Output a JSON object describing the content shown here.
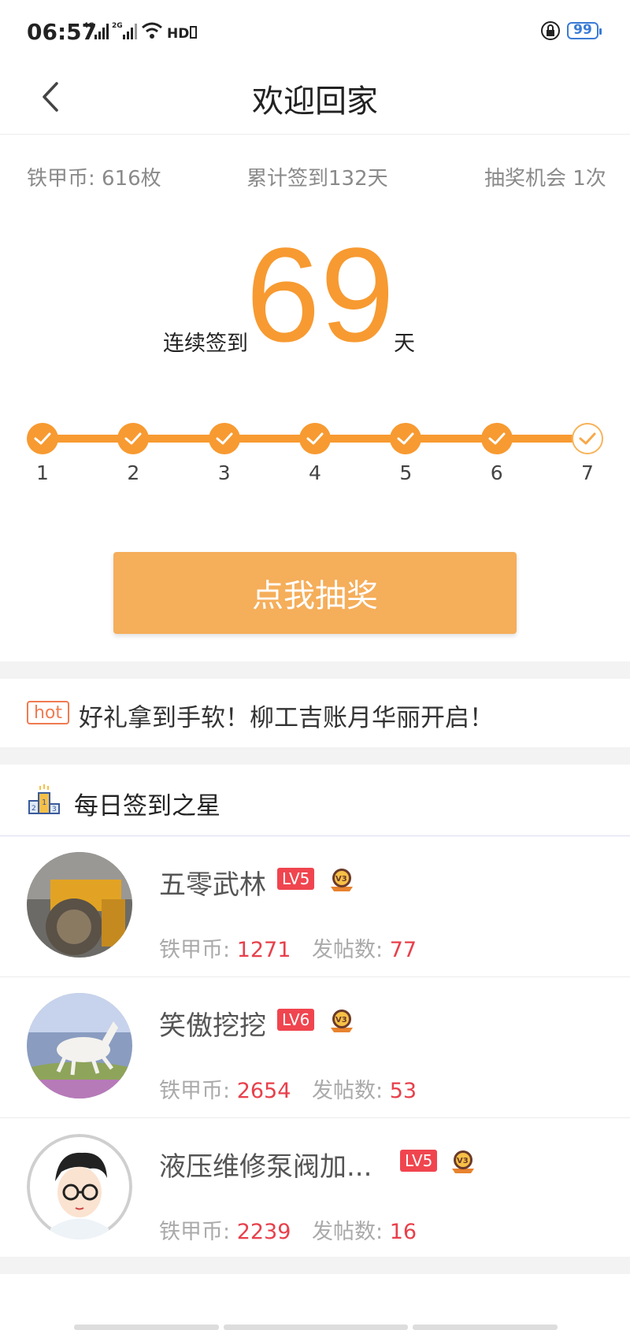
{
  "status_bar": {
    "time": "06:57",
    "battery": "99"
  },
  "header": {
    "title": "欢迎回家"
  },
  "stats": {
    "coins": "铁甲币: 616枚",
    "total_checkin": "累计签到132天",
    "lottery_chances": "抽奖机会 1次"
  },
  "streak": {
    "label": "连续签到",
    "days": "69",
    "unit": "天"
  },
  "progress": {
    "days": [
      "1",
      "2",
      "3",
      "4",
      "5",
      "6",
      "7"
    ],
    "checked": [
      true,
      true,
      true,
      true,
      true,
      true,
      false
    ]
  },
  "lottery_button": "点我抽奖",
  "hot_banner": {
    "tag": "hot",
    "text": "好礼拿到手软！柳工吉账月华丽开启！"
  },
  "star_section": {
    "title": "每日签到之星",
    "coin_label": "铁甲币:",
    "post_label": "发帖数:",
    "users": [
      {
        "name": "五零武林",
        "level": "LV5",
        "coins": "1271",
        "posts": "77"
      },
      {
        "name": "笑傲挖挖",
        "level": "LV6",
        "coins": "2654",
        "posts": "53"
      },
      {
        "name": "液压维修泵阀加...",
        "level": "LV5",
        "coins": "2239",
        "posts": "16"
      }
    ]
  },
  "colors": {
    "accent": "#f79a31",
    "button": "#f5ae5a",
    "level_badge": "#f0454f",
    "value_red": "#e8404b"
  }
}
